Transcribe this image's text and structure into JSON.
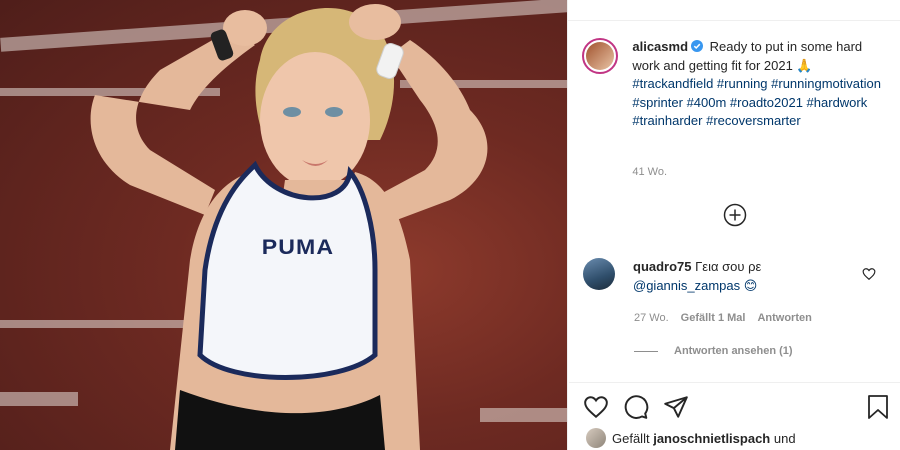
{
  "post": {
    "caption": {
      "username": "alicasmd",
      "text": "Ready to put in some hard work and getting fit for 2021 🙏",
      "hashtags": "#trackandfield #running #runningmotivation #sprinter #400m #roadto2021 #hardwork #trainharder #recoversmarter",
      "time": "41 Wo."
    },
    "comment": {
      "username": "quadro75",
      "text": "Γεια σου ρε",
      "mention": "@giannis_zampas 😊",
      "time": "27 Wo.",
      "likes": "Gefällt 1 Mal",
      "reply": "Antworten",
      "view_replies": "Antworten ansehen (1)"
    },
    "likes": {
      "prefix": "Gefällt",
      "user": "janoschnietlispach",
      "suffix": "und"
    },
    "photo": {
      "shirt_text": "PUMA"
    }
  },
  "icons": [
    "verified-icon",
    "load-more-icon",
    "heart-icon",
    "comment-icon",
    "share-icon",
    "save-icon"
  ],
  "colors": {
    "link": "#00376b",
    "muted": "#8e8e8e",
    "text": "#262626",
    "verified": "#3897f0",
    "track": "#6e2a22"
  }
}
